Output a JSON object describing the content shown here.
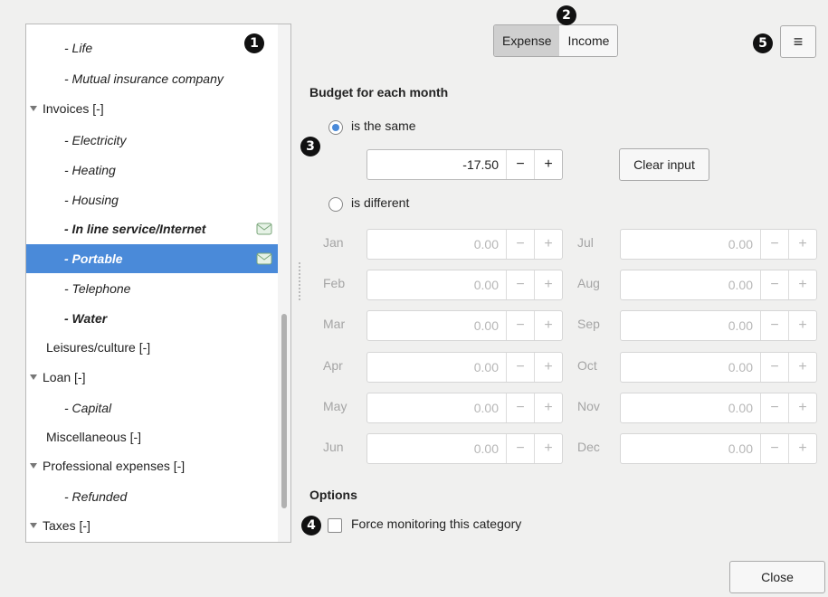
{
  "tree": {
    "rows": [
      {
        "label": "- Life",
        "style": "child bold-ish"
      },
      {
        "label": "- Mutual insurance company",
        "style": "child"
      },
      {
        "label": "Invoices [-]",
        "style": "parent"
      },
      {
        "label": "- Electricity",
        "style": "child"
      },
      {
        "label": "- Heating",
        "style": "child"
      },
      {
        "label": "- Housing",
        "style": "child"
      },
      {
        "label": "- In line service/Internet",
        "style": "child bold"
      },
      {
        "label": "- Portable",
        "style": "child bold selected"
      },
      {
        "label": "- Telephone",
        "style": "child"
      },
      {
        "label": "- Water",
        "style": "child bold"
      },
      {
        "label": "Leisures/culture [-]",
        "style": "top"
      },
      {
        "label": "Loan [-]",
        "style": "parent"
      },
      {
        "label": "- Capital",
        "style": "child"
      },
      {
        "label": "Miscellaneous [-]",
        "style": "top"
      },
      {
        "label": "Professional expenses [-]",
        "style": "parent"
      },
      {
        "label": "- Refunded",
        "style": "child"
      },
      {
        "label": "Taxes [-]",
        "style": "parent"
      }
    ]
  },
  "annotations": {
    "b1": "1",
    "b2": "2",
    "b3": "3",
    "b4": "4",
    "b5": "5"
  },
  "toggle": {
    "expense": "Expense",
    "income": "Income"
  },
  "menu_icon": "≡",
  "budget": {
    "heading": "Budget for each month",
    "same_label": "is the same",
    "same_value": "-17.50",
    "minus": "−",
    "plus": "+",
    "clear_label": "Clear input",
    "different_label": "is different"
  },
  "months": [
    {
      "name": "Jan",
      "value": "0.00"
    },
    {
      "name": "Feb",
      "value": "0.00"
    },
    {
      "name": "Mar",
      "value": "0.00"
    },
    {
      "name": "Apr",
      "value": "0.00"
    },
    {
      "name": "May",
      "value": "0.00"
    },
    {
      "name": "Jun",
      "value": "0.00"
    },
    {
      "name": "Jul",
      "value": "0.00"
    },
    {
      "name": "Aug",
      "value": "0.00"
    },
    {
      "name": "Sep",
      "value": "0.00"
    },
    {
      "name": "Oct",
      "value": "0.00"
    },
    {
      "name": "Nov",
      "value": "0.00"
    },
    {
      "name": "Dec",
      "value": "0.00"
    }
  ],
  "options": {
    "heading": "Options",
    "force_label": "Force monitoring this category"
  },
  "close_label": "Close",
  "colors": {
    "selected": "#4a8ad9",
    "disabled_text": "#b7b7b7"
  }
}
